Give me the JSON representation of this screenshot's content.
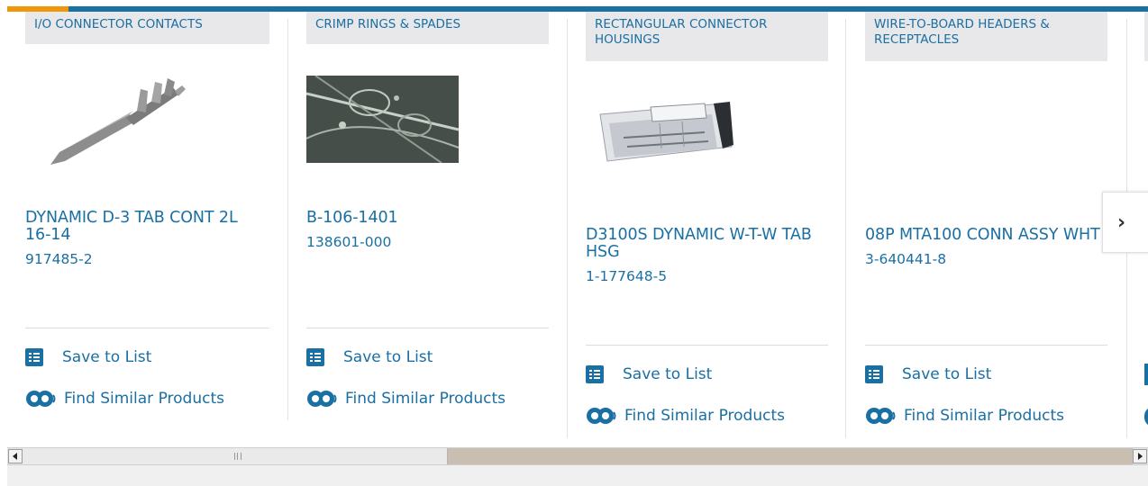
{
  "cards": [
    {
      "category": "I/O CONNECTOR CONTACTS",
      "title": "DYNAMIC D-3 TAB CONT 2L 16-14",
      "part_number": "917485-2",
      "save_label": "Save to List",
      "similar_label": "Find Similar Products"
    },
    {
      "category": "CRIMP RINGS & SPADES",
      "title": "B-106-1401",
      "part_number": "138601-000",
      "save_label": "Save to List",
      "similar_label": "Find Similar Products"
    },
    {
      "category": "RECTANGULAR CONNECTOR HOUSINGS",
      "title": "D3100S DYNAMIC W-T-W TAB HSG",
      "part_number": "1-177648-5",
      "save_label": "Save to List",
      "similar_label": "Find Similar Products"
    },
    {
      "category": "WIRE-TO-BOARD HEADERS & RECEPTACLES",
      "title": "08P MTA100 CONN ASSY WHT",
      "part_number": "3-640441-8",
      "save_label": "Save to List",
      "similar_label": "Find Similar Products"
    }
  ],
  "carousel": {
    "next_icon": "chevron-right-icon",
    "next_glyph": "›"
  },
  "scrollbar": {
    "position_fraction": 0.0,
    "visible_fraction": 0.38
  },
  "colors": {
    "brand_blue": "#1a6fa3",
    "accent_orange": "#f0960a",
    "category_bg": "#e8e8ea"
  }
}
